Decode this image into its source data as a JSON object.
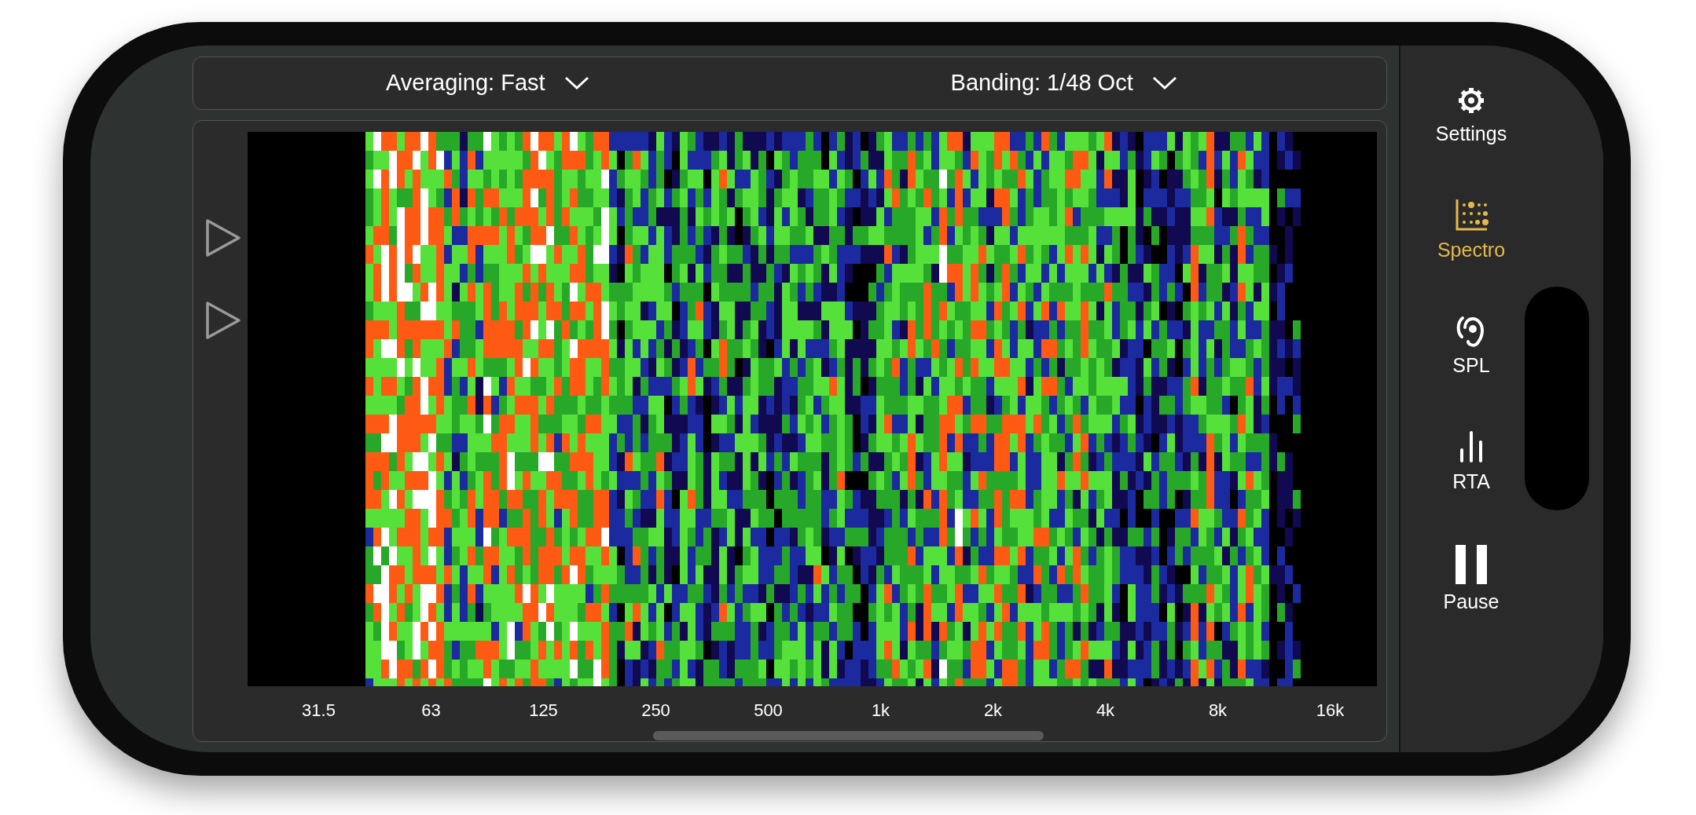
{
  "controls": [
    {
      "label": "Averaging: Fast",
      "kind": "dropdown"
    },
    {
      "label": "Banding: 1/48 Oct",
      "kind": "dropdown"
    }
  ],
  "frequency_labels": [
    "31.5",
    "63",
    "125",
    "250",
    "500",
    "1k",
    "2k",
    "4k",
    "8k",
    "16k"
  ],
  "nav": [
    {
      "label": "Settings",
      "kind": "settings",
      "selected": false
    },
    {
      "label": "Spectro",
      "kind": "spectro",
      "selected": true
    },
    {
      "label": "SPL",
      "kind": "spl",
      "selected": false
    },
    {
      "label": "RTA",
      "kind": "rta",
      "selected": false
    },
    {
      "label": "Pause",
      "kind": "pause",
      "selected": false
    }
  ]
}
